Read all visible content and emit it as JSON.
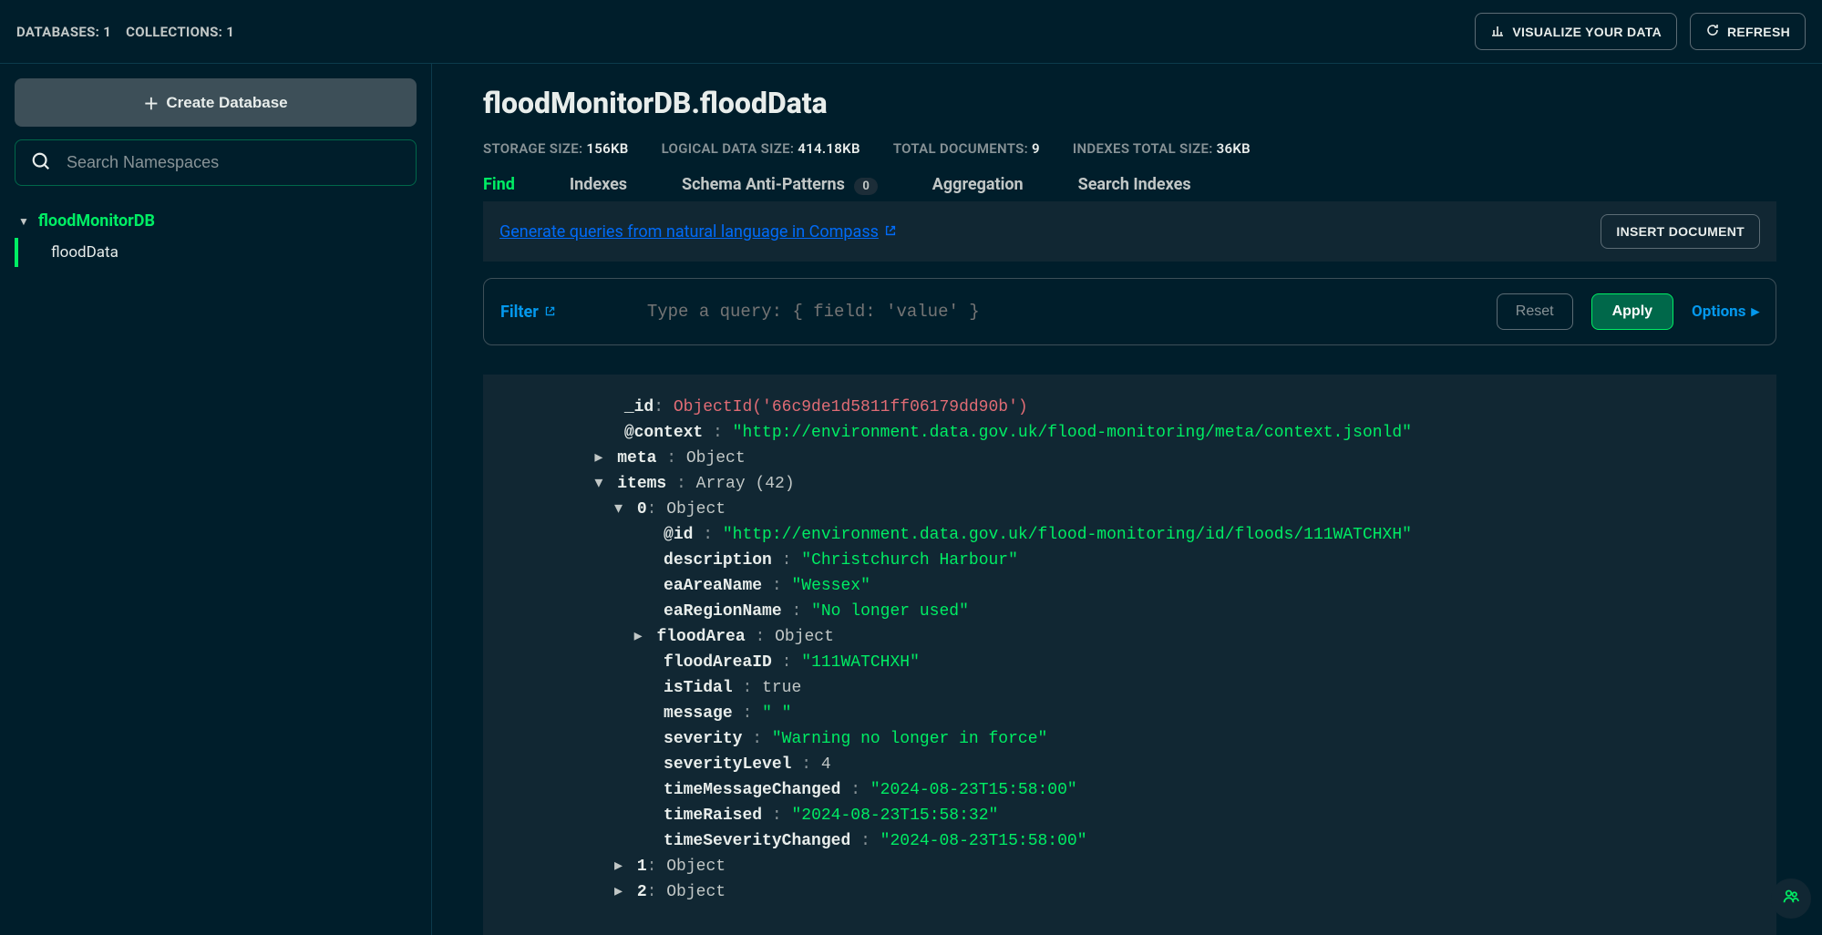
{
  "topbar": {
    "databases_label": "DATABASES:",
    "databases_count": "1",
    "collections_label": "COLLECTIONS:",
    "collections_count": "1",
    "visualize": "VISUALIZE YOUR DATA",
    "refresh": "REFRESH"
  },
  "sidebar": {
    "create_db": "Create Database",
    "search_placeholder": "Search Namespaces",
    "database": "floodMonitorDB",
    "collection": "floodData"
  },
  "header": {
    "title": "floodMonitorDB.floodData",
    "stats": {
      "storage_label": "STORAGE SIZE:",
      "storage_value": "156KB",
      "logical_label": "LOGICAL DATA SIZE:",
      "logical_value": "414.18KB",
      "docs_label": "TOTAL DOCUMENTS:",
      "docs_value": "9",
      "indexes_label": "INDEXES TOTAL SIZE:",
      "indexes_value": "36KB"
    },
    "tabs": {
      "find": "Find",
      "indexes": "Indexes",
      "schema": "Schema Anti-Patterns",
      "schema_badge": "0",
      "aggregation": "Aggregation",
      "search_indexes": "Search Indexes"
    }
  },
  "actions": {
    "compass_link": "Generate queries from natural language in Compass",
    "insert": "INSERT DOCUMENT",
    "filter": "Filter",
    "query_placeholder": "Type a query: { field: 'value' }",
    "reset": "Reset",
    "apply": "Apply",
    "options": "Options"
  },
  "doc": {
    "id_key": "_id",
    "id_val": "ObjectId('66c9de1d5811ff06179dd90b')",
    "context_key": "@context",
    "context_val": "\"http://environment.data.gov.uk/flood-monitoring/meta/context.jsonld\"",
    "meta_key": "meta",
    "meta_type": "Object",
    "items_key": "items",
    "items_type": "Array (42)",
    "idx0": "0",
    "object": "Object",
    "at_id_key": "@id",
    "at_id_val": "\"http://environment.data.gov.uk/flood-monitoring/id/floods/111WATCHXH\"",
    "desc_key": "description",
    "desc_val": "\"Christchurch Harbour\"",
    "eaArea_key": "eaAreaName",
    "eaArea_val": "\"Wessex\"",
    "eaRegion_key": "eaRegionName",
    "eaRegion_val": "\"No longer used\"",
    "floodArea_key": "floodArea",
    "floodAreaID_key": "floodAreaID",
    "floodAreaID_val": "\"111WATCHXH\"",
    "isTidal_key": "isTidal",
    "isTidal_val": "true",
    "message_key": "message",
    "message_val": "\" \"",
    "severity_key": "severity",
    "severity_val": "\"Warning no longer in force\"",
    "severityLevel_key": "severityLevel",
    "severityLevel_val": "4",
    "tmc_key": "timeMessageChanged",
    "tmc_val": "\"2024-08-23T15:58:00\"",
    "tr_key": "timeRaised",
    "tr_val": "\"2024-08-23T15:58:32\"",
    "tsc_key": "timeSeverityChanged",
    "tsc_val": "\"2024-08-23T15:58:00\"",
    "idx1": "1",
    "idx2": "2"
  }
}
